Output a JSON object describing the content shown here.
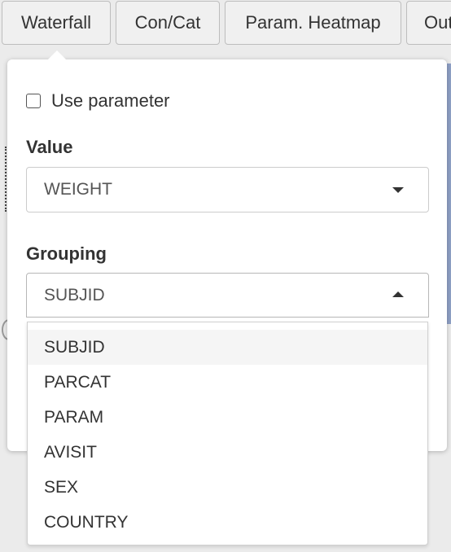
{
  "tabs": [
    {
      "label": "Waterfall"
    },
    {
      "label": "Con/Cat"
    },
    {
      "label": "Param. Heatmap"
    },
    {
      "label": "Out"
    }
  ],
  "panel": {
    "use_parameter_label": "Use parameter",
    "use_parameter_checked": false,
    "value": {
      "label": "Value",
      "selected": "WEIGHT"
    },
    "grouping": {
      "label": "Grouping",
      "selected": "SUBJID",
      "options": [
        "SUBJID",
        "PARCAT",
        "PARAM",
        "AVISIT",
        "SEX",
        "COUNTRY"
      ]
    }
  },
  "colors": {
    "background": "#ebebeb",
    "popover": "#ffffff",
    "active_option": "#f5f5f5"
  }
}
